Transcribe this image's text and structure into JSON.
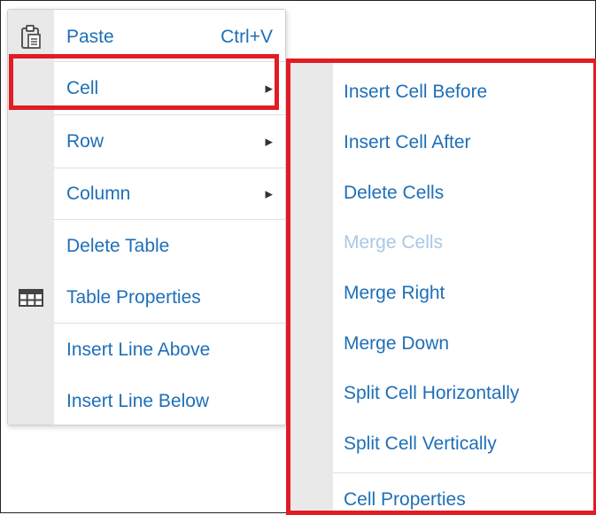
{
  "menu": {
    "paste": {
      "label": "Paste",
      "shortcut": "Ctrl+V",
      "icon": "clipboard-icon"
    },
    "cell": {
      "label": "Cell",
      "has_submenu": true
    },
    "row": {
      "label": "Row",
      "has_submenu": true
    },
    "column": {
      "label": "Column",
      "has_submenu": true
    },
    "delete_table": {
      "label": "Delete Table"
    },
    "table_properties": {
      "label": "Table Properties",
      "icon": "table-icon"
    },
    "insert_line_above": {
      "label": "Insert Line Above"
    },
    "insert_line_below": {
      "label": "Insert Line Below"
    },
    "submenu_arrow": "▶"
  },
  "submenu": {
    "items": [
      {
        "label": "Insert Cell Before",
        "enabled": true
      },
      {
        "label": "Insert Cell After",
        "enabled": true
      },
      {
        "label": "Delete Cells",
        "enabled": true
      },
      {
        "label": "Merge Cells",
        "enabled": false
      },
      {
        "label": "Merge Right",
        "enabled": true
      },
      {
        "label": "Merge Down",
        "enabled": true
      },
      {
        "label": "Split Cell Horizontally",
        "enabled": true
      },
      {
        "label": "Split Cell Vertically",
        "enabled": true
      },
      {
        "label": "Cell Properties",
        "enabled": true
      }
    ]
  },
  "colors": {
    "link": "#1e6fb8",
    "disabled": "#a9c8e4",
    "highlight": "#e01c24",
    "gutter": "#e9e9e9"
  }
}
